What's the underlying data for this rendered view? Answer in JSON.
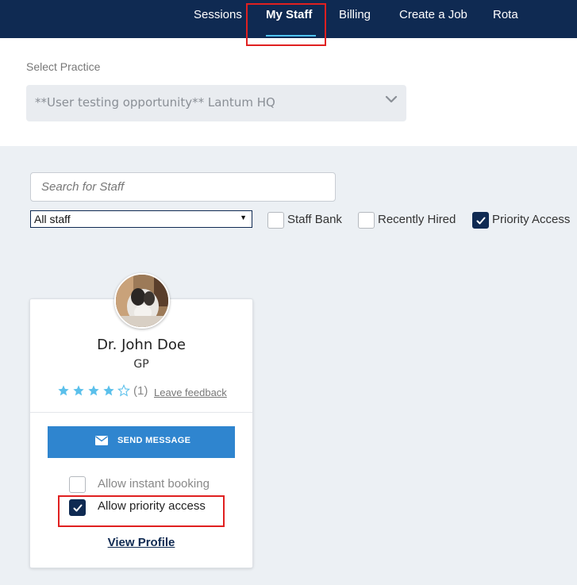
{
  "nav": {
    "items": [
      {
        "label": "Sessions"
      },
      {
        "label": "My Staff",
        "active": true
      },
      {
        "label": "Billing"
      },
      {
        "label": "Create a Job"
      },
      {
        "label": "Rota"
      }
    ]
  },
  "practice": {
    "label": "Select Practice",
    "selected": "**User testing opportunity** Lantum HQ"
  },
  "filters": {
    "search_placeholder": "Search for Staff",
    "staff_select": "All staff",
    "checkboxes": [
      {
        "label": "Staff Bank",
        "checked": false
      },
      {
        "label": "Recently Hired",
        "checked": false
      },
      {
        "label": "Priority Access",
        "checked": true
      }
    ]
  },
  "staff_card": {
    "name": "Dr. John Doe",
    "role": "GP",
    "rating": 4,
    "rating_max": 5,
    "review_count": "(1)",
    "leave_feedback": "Leave feedback",
    "send_message": "SEND MESSAGE",
    "allow_instant_booking": {
      "label": "Allow instant booking",
      "checked": false
    },
    "allow_priority_access": {
      "label": "Allow priority access",
      "checked": true
    },
    "view_profile": "View Profile"
  },
  "colors": {
    "nav_bg": "#0f2a52",
    "accent_underline": "#4fc3f7",
    "button_blue": "#2f85cf",
    "star": "#5bc0eb",
    "highlight_box": "#e02020"
  }
}
